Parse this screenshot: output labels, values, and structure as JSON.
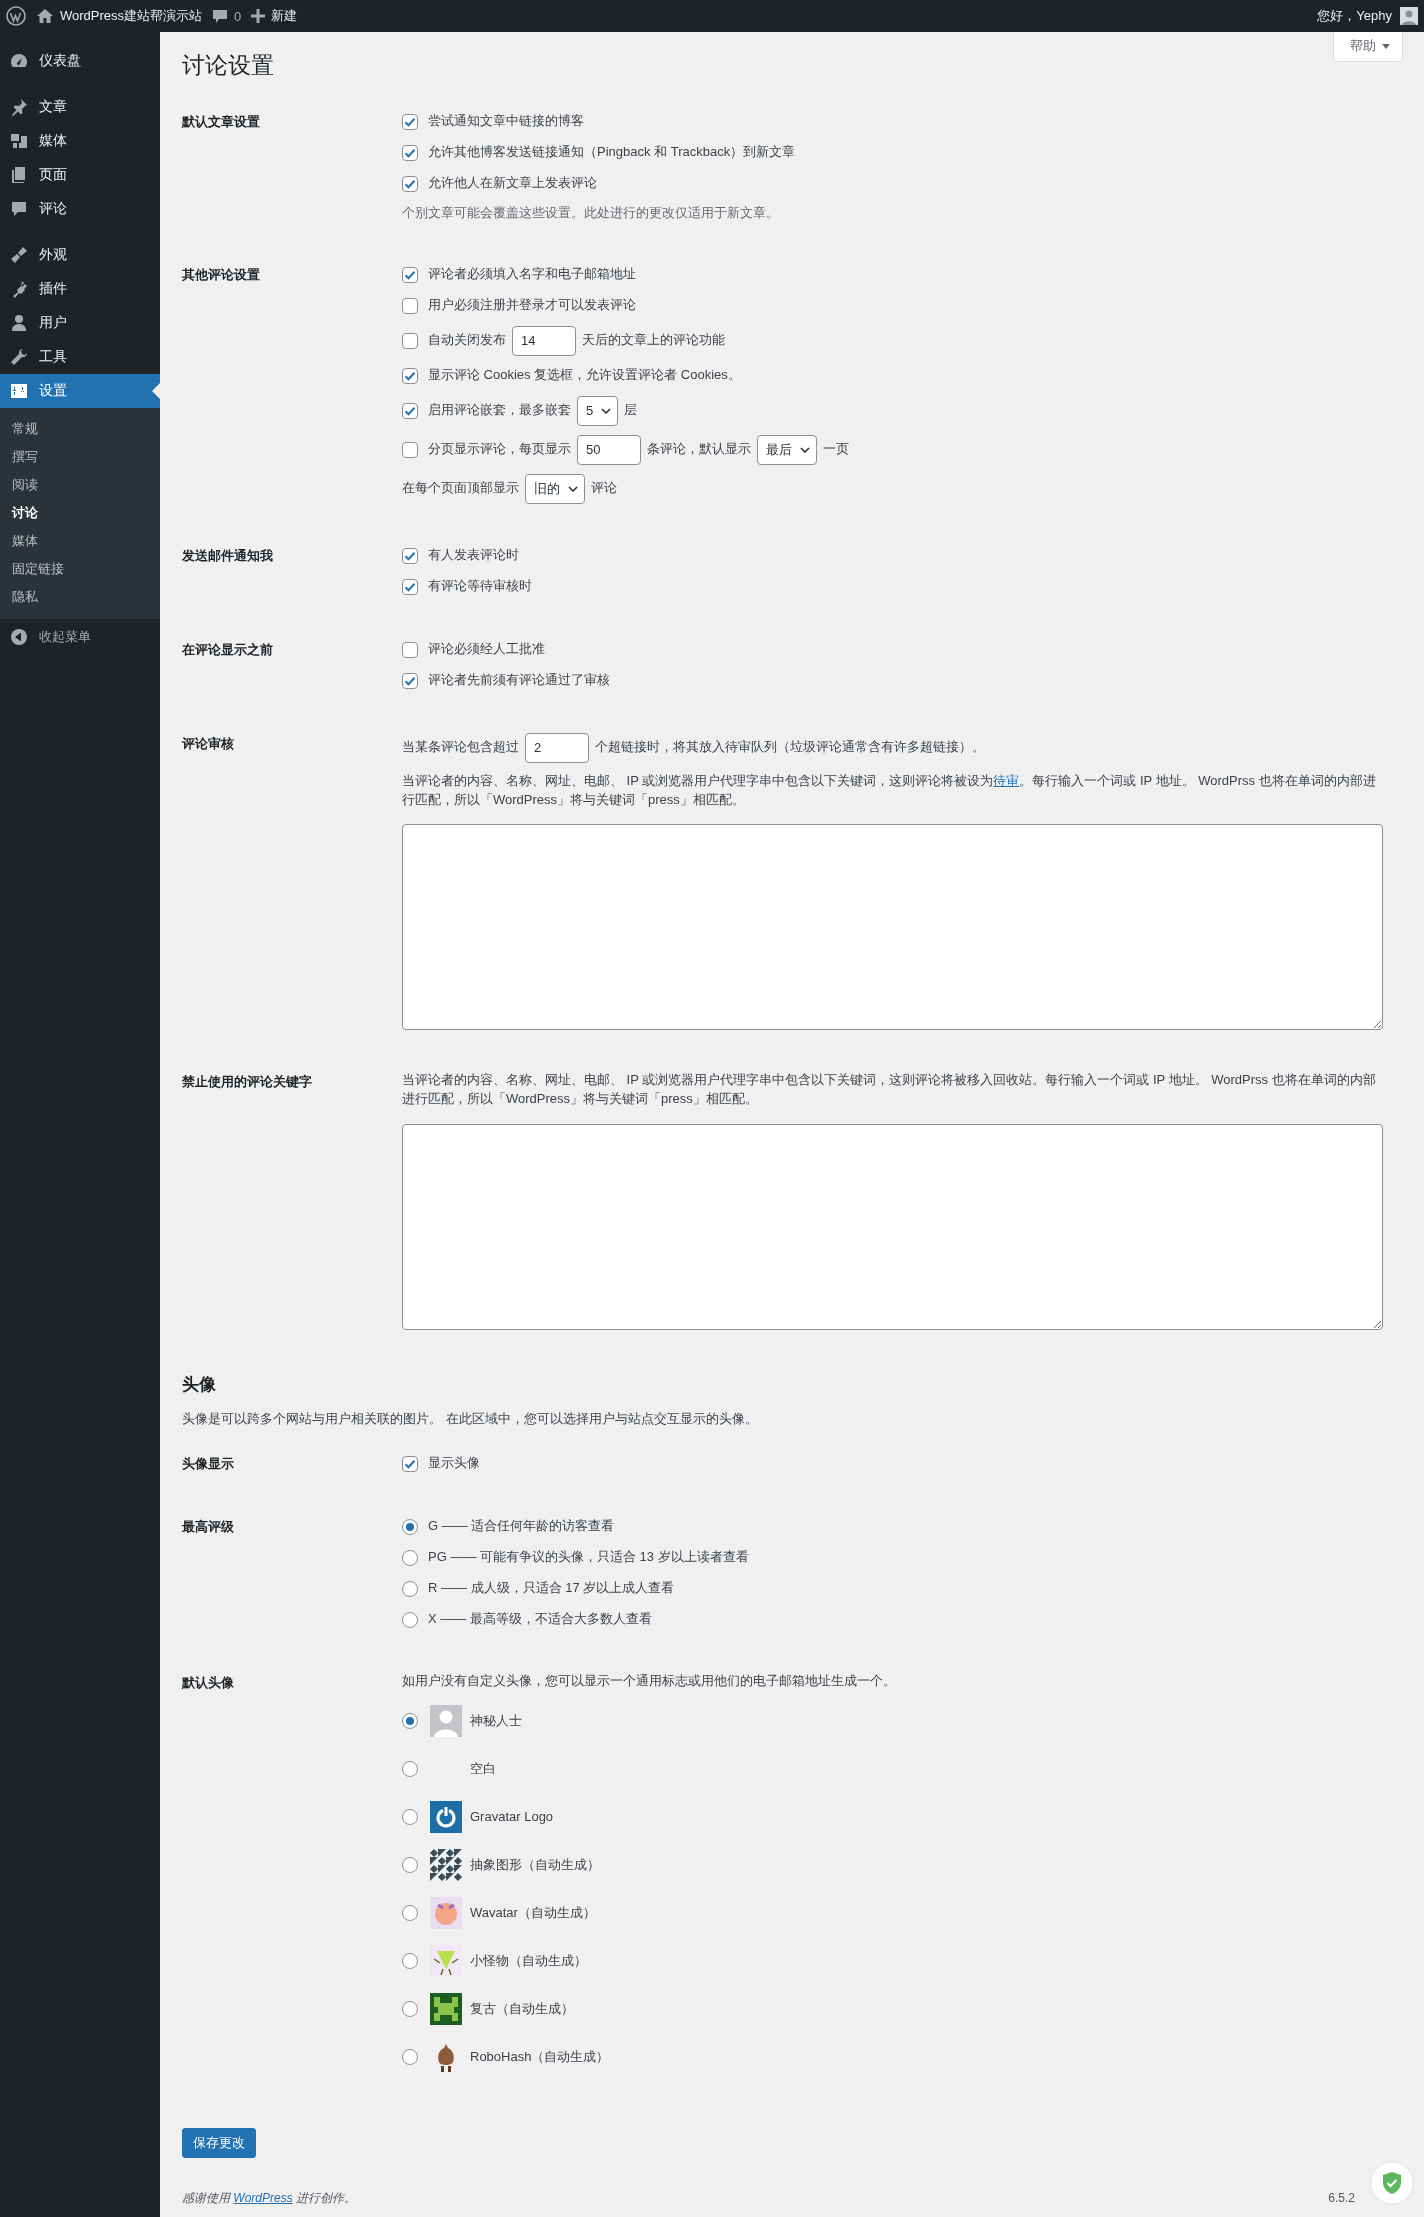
{
  "admin_bar": {
    "site_name": "WordPress建站帮演示站",
    "comments_count": "0",
    "new_label": "新建",
    "greeting": "您好，Yephy"
  },
  "sidebar": {
    "groups": [
      {
        "items": [
          {
            "label": "仪表盘",
            "selected": false
          }
        ]
      },
      {
        "items": [
          {
            "label": "文章",
            "selected": false
          },
          {
            "label": "媒体",
            "selected": false
          },
          {
            "label": "页面",
            "selected": false
          },
          {
            "label": "评论",
            "selected": false
          }
        ]
      },
      {
        "items": [
          {
            "label": "外观",
            "selected": false
          },
          {
            "label": "插件",
            "selected": false
          },
          {
            "label": "用户",
            "selected": false
          },
          {
            "label": "工具",
            "selected": false
          },
          {
            "label": "设置",
            "selected": true,
            "children": [
              {
                "label": "常规",
                "selected": false
              },
              {
                "label": "撰写",
                "selected": false
              },
              {
                "label": "阅读",
                "selected": false
              },
              {
                "label": "讨论",
                "selected": true
              },
              {
                "label": "媒体",
                "selected": false
              },
              {
                "label": "固定链接",
                "selected": false
              },
              {
                "label": "隐私",
                "selected": false
              }
            ]
          }
        ]
      }
    ],
    "collapse_label": "收起菜单"
  },
  "help_label": "帮助",
  "page_title": "讨论设置",
  "discussion_rows": [
    {
      "label": "默认文章设置",
      "items": [
        {
          "kind": "check",
          "label": "尝试通知文章中链接的博客",
          "checked": true
        },
        {
          "kind": "check",
          "label": "允许其他博客发送链接通知（Pingback 和 Trackback）到新文章",
          "checked": true
        },
        {
          "kind": "check",
          "label": "允许他人在新文章上发表评论",
          "checked": true
        },
        {
          "kind": "note",
          "text": "个别文章可能会覆盖这些设置。此处进行的更改仅适用于新文章。"
        }
      ]
    },
    {
      "label": "其他评论设置",
      "items": [
        {
          "kind": "check",
          "label": "评论者必须填入名字和电子邮箱地址",
          "checked": true
        },
        {
          "kind": "check",
          "label": "用户必须注册并登录才可以发表评论",
          "checked": false
        },
        {
          "kind": "check_parts",
          "checked": false,
          "parts": [
            {
              "kind": "text",
              "text": "自动关闭发布"
            },
            {
              "kind": "input",
              "value": "14"
            },
            {
              "kind": "text",
              "text": "天后的文章上的评论功能"
            }
          ]
        },
        {
          "kind": "check",
          "label": "显示评论 Cookies 复选框，允许设置评论者 Cookies。",
          "checked": true
        },
        {
          "kind": "check_parts",
          "checked": true,
          "parts": [
            {
              "kind": "text",
              "text": "启用评论嵌套，最多嵌套"
            },
            {
              "kind": "select",
              "value": "5"
            },
            {
              "kind": "text",
              "text": "层"
            }
          ]
        },
        {
          "kind": "check_parts",
          "checked": false,
          "parts": [
            {
              "kind": "text",
              "text": "分页显示评论，每页显示"
            },
            {
              "kind": "input",
              "value": "50"
            },
            {
              "kind": "text",
              "text": "条评论，默认显示"
            },
            {
              "kind": "select",
              "value": "最后"
            },
            {
              "kind": "text",
              "text": "一页"
            }
          ]
        },
        {
          "kind": "parts",
          "parts": [
            {
              "kind": "text",
              "text": "在每个页面顶部显示"
            },
            {
              "kind": "select",
              "value": "旧的"
            },
            {
              "kind": "text",
              "text": "评论"
            }
          ]
        }
      ]
    },
    {
      "label": "发送邮件通知我",
      "items": [
        {
          "kind": "check",
          "label": "有人发表评论时",
          "checked": true
        },
        {
          "kind": "check",
          "label": "有评论等待审核时",
          "checked": true
        }
      ]
    },
    {
      "label": "在评论显示之前",
      "items": [
        {
          "kind": "check",
          "label": "评论必须经人工批准",
          "checked": false
        },
        {
          "kind": "check",
          "label": "评论者先前须有评论通过了审核",
          "checked": true
        }
      ]
    },
    {
      "label": "评论审核",
      "items": [
        {
          "kind": "parts",
          "parts": [
            {
              "kind": "text",
              "text": "当某条评论包含超过"
            },
            {
              "kind": "input",
              "value": "2"
            },
            {
              "kind": "text",
              "text": "个超链接时，将其放入待审队列（垃圾评论通常含有许多超链接）。"
            }
          ]
        },
        {
          "kind": "paragraph",
          "parts": [
            {
              "kind": "text",
              "text": "当评论者的内容、名称、网址、电邮、 IP 或浏览器用户代理字串中包含以下关键词，这则评论将被设为"
            },
            {
              "kind": "link",
              "text": "待审"
            },
            {
              "kind": "text",
              "text": "。每行输入一个词或 IP 地址。 WordPrss 也将在单词的内部进行匹配，所以「WordPress」将与关键词「press」相匹配。"
            }
          ]
        },
        {
          "kind": "textarea"
        }
      ]
    },
    {
      "label": "禁止使用的评论关键字",
      "items": [
        {
          "kind": "paragraph",
          "parts": [
            {
              "kind": "text",
              "text": "当评论者的内容、名称、网址、电邮、 IP 或浏览器用户代理字串中包含以下关键词，这则评论将被移入回收站。每行输入一个词或 IP 地址。 WordPrss 也将在单词的内部进行匹配，所以「WordPress」将与关键词「press」相匹配。"
            }
          ]
        },
        {
          "kind": "textarea"
        }
      ]
    }
  ],
  "avatars": {
    "title": "头像",
    "description": "头像是可以跨多个网站与用户相关联的图片。 在此区域中，您可以选择用户与站点交互显示的头像。",
    "rows": [
      {
        "label": "头像显示",
        "items": [
          {
            "kind": "check",
            "label": "显示头像",
            "checked": true
          }
        ]
      },
      {
        "label": "最高评级",
        "items": [
          {
            "kind": "radio",
            "label": "G —— 适合任何年龄的访客查看",
            "selected": true
          },
          {
            "kind": "radio",
            "label": "PG —— 可能有争议的头像，只适合 13 岁以上读者查看",
            "selected": false
          },
          {
            "kind": "radio",
            "label": "R —— 成人级，只适合 17 岁以上成人查看",
            "selected": false
          },
          {
            "kind": "radio",
            "label": "X —— 最高等级，不适合大多数人查看",
            "selected": false
          }
        ]
      },
      {
        "label": "默认头像",
        "items": [
          {
            "kind": "text",
            "text": "如用户没有自定义头像，您可以显示一个通用标志或用他们的电子邮箱地址生成一个。"
          }
        ],
        "avatar_options": [
          {
            "kind": "mystery",
            "label": "神秘人士",
            "selected": true
          },
          {
            "kind": "blank",
            "label": "空白",
            "selected": false
          },
          {
            "kind": "gravatar",
            "label": "Gravatar Logo",
            "selected": false
          },
          {
            "kind": "identicon",
            "label": "抽象图形（自动生成）",
            "selected": false
          },
          {
            "kind": "wavatar",
            "label": "Wavatar（自动生成）",
            "selected": false
          },
          {
            "kind": "monsterid",
            "label": "小怪物（自动生成）",
            "selected": false
          },
          {
            "kind": "retro",
            "label": "复古（自动生成）",
            "selected": false
          },
          {
            "kind": "robohash",
            "label": "RoboHash（自动生成）",
            "selected": false
          }
        ]
      }
    ]
  },
  "save_button": "保存更改",
  "footer": {
    "parts": [
      {
        "kind": "text",
        "text": "感谢使用 "
      },
      {
        "kind": "link",
        "text": "WordPress"
      },
      {
        "kind": "text",
        "text": " 进行创作。"
      }
    ],
    "version": "6.5.2"
  }
}
